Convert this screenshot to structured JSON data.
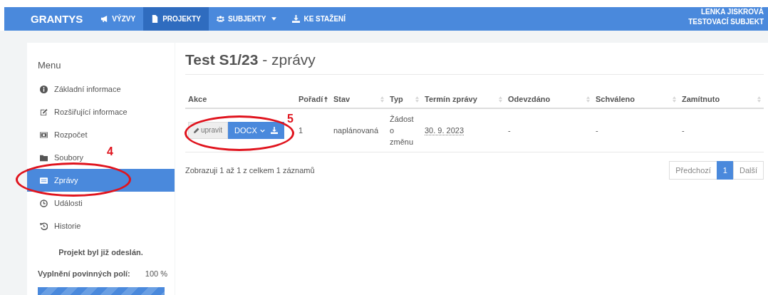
{
  "navbar": {
    "brand": "GRANTYS",
    "items": [
      {
        "label": "VÝZVY",
        "selected": false,
        "dropdown": false
      },
      {
        "label": "PROJEKTY",
        "selected": true,
        "dropdown": false
      },
      {
        "label": "SUBJEKTY",
        "selected": false,
        "dropdown": true
      },
      {
        "label": "KE STAŽENÍ",
        "selected": false,
        "dropdown": false
      }
    ],
    "user": {
      "name": "LENKA JISKROVÁ",
      "organization": "TESTOVACÍ SUBJEKT"
    }
  },
  "sidebar": {
    "title": "Menu",
    "items": [
      {
        "label": "Základní informace",
        "selected": false
      },
      {
        "label": "Rozšiřující informace",
        "selected": false
      },
      {
        "label": "Rozpočet",
        "selected": false
      },
      {
        "label": "Soubory",
        "selected": false
      },
      {
        "label": "Zprávy",
        "selected": true
      },
      {
        "label": "Události",
        "selected": false
      },
      {
        "label": "Historie",
        "selected": false
      }
    ],
    "status": "Projekt byl již odeslán.",
    "progress": {
      "label": "Vyplnění povinných polí:",
      "reading": "100 %",
      "level": 1
    }
  },
  "page": {
    "title": "**Test S1/23** - zprávy"
  },
  "table": {
    "columns": [
      {
        "label": "Akce"
      },
      {
        "label": "Pořadí",
        "sorted": true
      },
      {
        "label": "Stav",
        "sorted": false
      },
      {
        "label": "Typ",
        "sorted": false
      },
      {
        "label": "Termín zprávy",
        "sorted": false
      },
      {
        "label": "Odevzdáno",
        "sorted": false
      },
      {
        "label": "Schváleno",
        "sorted": false
      },
      {
        "label": "Zamítnuto",
        "sorted": false
      }
    ],
    "rows": [
      {
        "cells": [
          {
            "buttons": [
              "upravit",
              "DOCX"
            ]
          },
          "1",
          "naplánovaná",
          "Žádost o změnu",
          "30. 9. 2023",
          "-",
          "-",
          "-"
        ]
      }
    ]
  },
  "footer": {
    "info": "Zobrazuji 1 až 1 z celkem 1 záznamů",
    "pagination": [
      {
        "label": "Předchozí",
        "selected": false
      },
      {
        "label": "1",
        "selected": true
      },
      {
        "label": "Další",
        "selected": false
      }
    ]
  },
  "annotations": [
    {
      "label": "4"
    },
    {
      "label": "5"
    }
  ]
}
